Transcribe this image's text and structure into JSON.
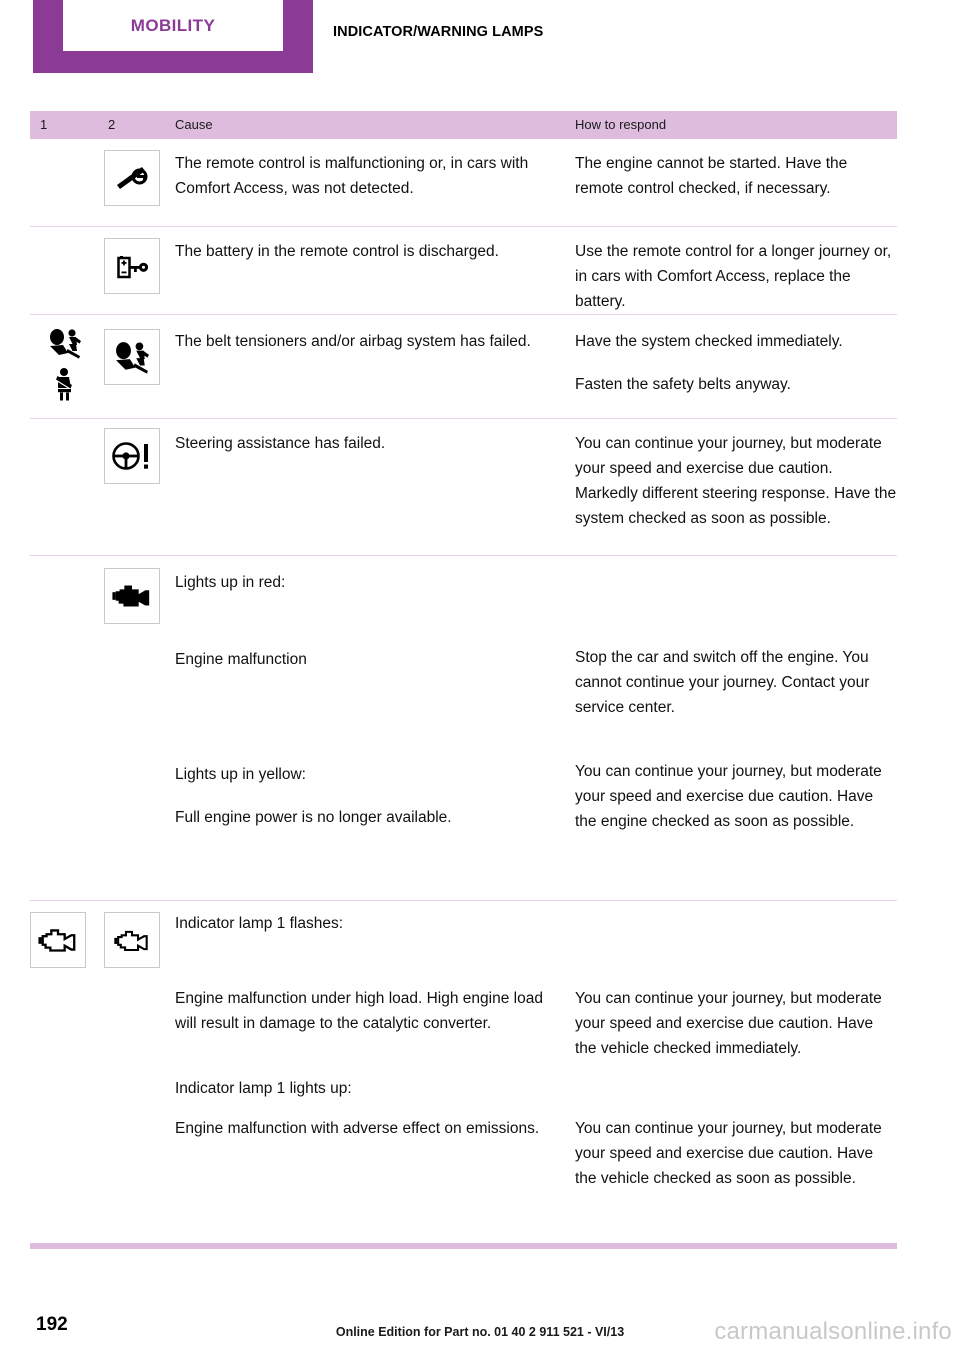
{
  "header": {
    "chapter_tab_label": "MOBILITY",
    "section_title": "INDICATOR/WARNING LAMPS",
    "tab_color": "#8B3A95",
    "tab_text_color": "#8B3A95"
  },
  "table": {
    "accent_color": "#DDBCDE",
    "rule_color": "#E7D3E8",
    "columns": {
      "col1": "1",
      "col2": "2",
      "cause": "Cause",
      "respond": "How to respond"
    },
    "rows": [
      {
        "icon1": null,
        "icon2": "key-crossed-out-icon",
        "cause": [
          "The remote control is malfunctioning or, in cars with Comfort Access, was not detected."
        ],
        "respond": [
          "The engine cannot be started. Have the remote control checked, if necessary."
        ]
      },
      {
        "icon1": null,
        "icon2": "battery-key-icon",
        "cause": [
          "The battery in the remote control is discharged."
        ],
        "respond": [
          "Use the remote control for a longer journey or, in cars with Comfort Access, replace the battery."
        ]
      },
      {
        "icon1": [
          "airbag-icon",
          "seatbelt-icon"
        ],
        "icon2": "airbag-icon",
        "cause": [
          "The belt tensioners and/or airbag system has failed."
        ],
        "respond": [
          "Have the system checked immediately.",
          "Fasten the safety belts anyway."
        ]
      },
      {
        "icon1": null,
        "icon2": "steering-wheel-warning-icon",
        "cause": [
          "Steering assistance has failed."
        ],
        "respond": [
          "You can continue your journey, but moderate your speed and exercise due caution. Markedly different steering response. Have the system checked as soon as possible."
        ]
      },
      {
        "icon1": null,
        "icon2": "engine-filled-icon",
        "cause": [
          "Lights up in red:",
          "Engine malfunction",
          "Lights up in yellow:",
          "Full engine power is no longer available."
        ],
        "respond": [
          "",
          "Stop the car and switch off the engine. You cannot continue your journey. Contact your service center.",
          "",
          "You can continue your journey, but moderate your speed and exercise due caution. Have the engine checked as soon as possible."
        ]
      },
      {
        "icon1": [
          "engine-outline-icon"
        ],
        "icon2": "engine-outline-icon",
        "cause": [
          "Indicator lamp 1 flashes:",
          "Engine malfunction under high load. High engine load will result in damage to the catalytic converter.",
          "Indicator lamp 1 lights up:",
          "Engine malfunction with adverse effect on emissions."
        ],
        "respond": [
          "",
          "You can continue your journey, but moderate your speed and exercise due caution. Have the vehicle checked immediately.",
          "",
          "You can continue your journey, but moderate your speed and exercise due caution. Have the vehicle checked as soon as possible."
        ]
      }
    ]
  },
  "footer": {
    "page_number": "192",
    "edition_note": "Online Edition for Part no. 01 40 2 911 521 - VI/13",
    "watermark": "carmanualsonline.info"
  }
}
